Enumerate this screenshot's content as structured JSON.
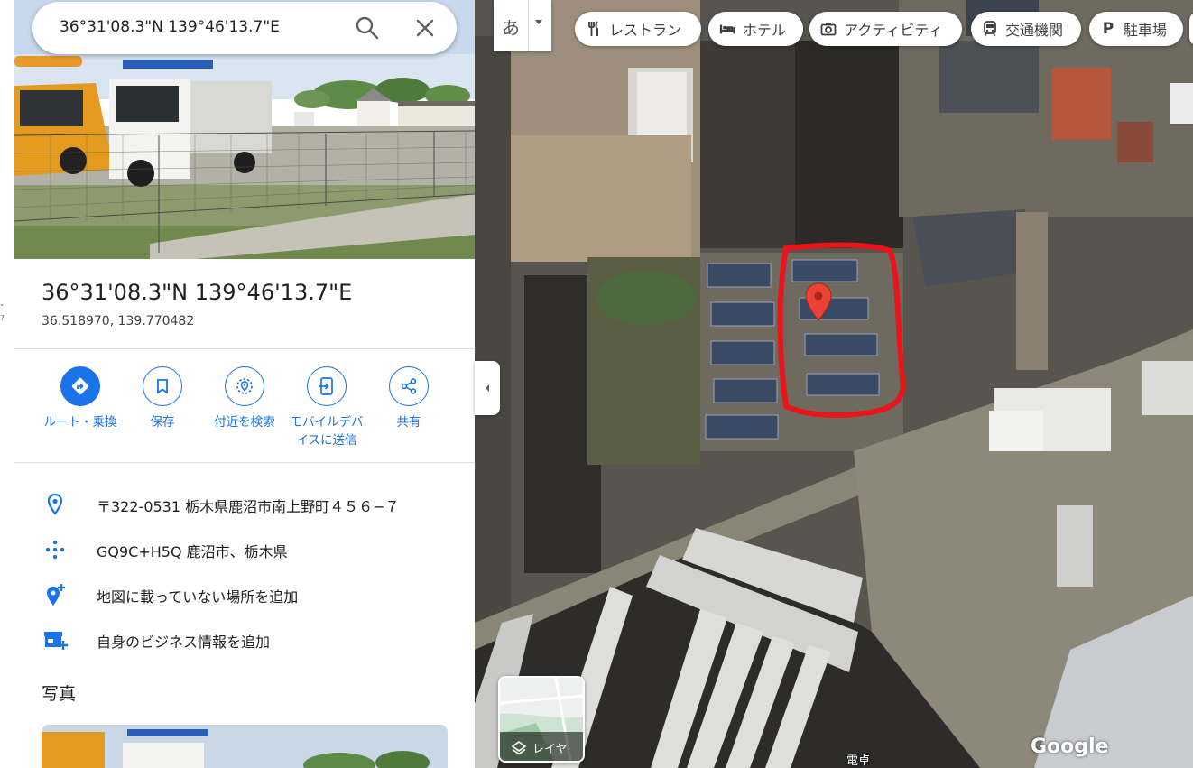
{
  "search": {
    "query": "36°31'08.3\"N 139°46'13.7\"E"
  },
  "place": {
    "title": "36°31'08.3\"N 139°46'13.7\"E",
    "decimal_coords": "36.518970, 139.770482"
  },
  "actions": [
    {
      "label": "ルート・乗換",
      "icon": "directions-icon"
    },
    {
      "label": "保存",
      "icon": "bookmark-icon"
    },
    {
      "label": "付近を検索",
      "icon": "nearby-search-icon"
    },
    {
      "label_line1": "モバイルデバ",
      "label_line2": "イスに送信",
      "icon": "send-to-phone-icon"
    },
    {
      "label": "共有",
      "icon": "share-icon"
    }
  ],
  "info": {
    "address": "〒322-0531 栃木県鹿沼市南上野町４５６−７",
    "plus_code": "GQ9C+H5Q 鹿沼市、栃木県",
    "add_missing_place": "地図に載っていない場所を追加",
    "add_business": "自身のビジネス情報を追加"
  },
  "photos_section": {
    "title": "写真"
  },
  "map": {
    "lang_button": "あ",
    "chips": [
      {
        "label": "レストラン",
        "icon": "restaurant-icon"
      },
      {
        "label": "ホテル",
        "icon": "hotel-icon"
      },
      {
        "label": "アクティビティ",
        "icon": "camera-icon"
      },
      {
        "label": "交通機関",
        "icon": "transit-icon"
      },
      {
        "label": "駐車場",
        "icon": "parking-icon"
      }
    ],
    "layers_label": "レイヤ",
    "logo": "Google",
    "place_label": "電卓"
  },
  "colors": {
    "accent": "#1a73e8",
    "marker": "#ea4335",
    "highlight": "#e8161b"
  }
}
